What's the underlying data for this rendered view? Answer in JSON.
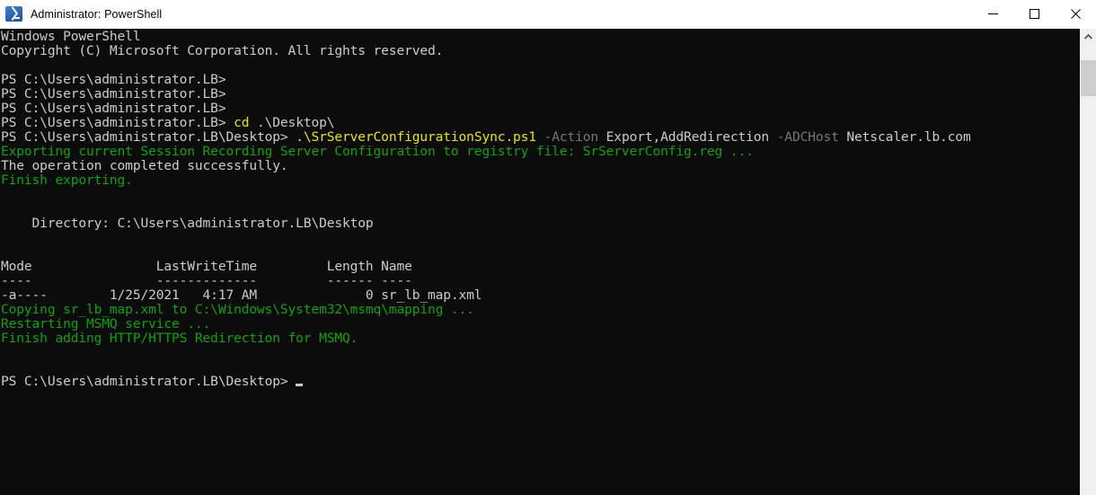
{
  "window": {
    "title": "Administrator: PowerShell",
    "icon": "powershell-icon",
    "background_color": "#0c0c0c",
    "titlebar_color": "#ffffff",
    "controls": {
      "minimize": "minimize-icon",
      "maximize": "maximize-icon",
      "close": "close-icon"
    }
  },
  "colors": {
    "foreground": "#cccccc",
    "green": "#13a10e",
    "yellow": "#e5e510",
    "gray": "#767676",
    "background": "#0c0c0c"
  },
  "scrollbar": {
    "up_arrow": "chevron-up-icon",
    "thumb_position_percent": 4
  },
  "console": {
    "lines": [
      {
        "id": "banner-1",
        "segments": [
          {
            "text": "Windows PowerShell",
            "color": "white"
          }
        ]
      },
      {
        "id": "banner-2",
        "segments": [
          {
            "text": "Copyright (C) Microsoft Corporation. All rights reserved.",
            "color": "white"
          }
        ]
      },
      {
        "id": "blank-1",
        "segments": [
          {
            "text": "",
            "color": "white"
          }
        ]
      },
      {
        "id": "prompt-1",
        "segments": [
          {
            "text": "PS C:\\Users\\administrator.LB>",
            "color": "white"
          }
        ]
      },
      {
        "id": "prompt-2",
        "segments": [
          {
            "text": "PS C:\\Users\\administrator.LB>",
            "color": "white"
          }
        ]
      },
      {
        "id": "prompt-3",
        "segments": [
          {
            "text": "PS C:\\Users\\administrator.LB>",
            "color": "white"
          }
        ]
      },
      {
        "id": "cmd-cd",
        "segments": [
          {
            "text": "PS C:\\Users\\administrator.LB> ",
            "color": "white"
          },
          {
            "text": "cd",
            "color": "yellow"
          },
          {
            "text": " .\\Desktop\\",
            "color": "white"
          }
        ]
      },
      {
        "id": "cmd-script",
        "segments": [
          {
            "text": "PS C:\\Users\\administrator.LB\\Desktop> ",
            "color": "white"
          },
          {
            "text": ".\\SrServerConfigurationSync.ps1",
            "color": "yellow"
          },
          {
            "text": " ",
            "color": "white"
          },
          {
            "text": "-Action",
            "color": "gray"
          },
          {
            "text": " Export,AddRedirection ",
            "color": "white"
          },
          {
            "text": "-ADCHost",
            "color": "gray"
          },
          {
            "text": " Netscaler.lb.com",
            "color": "white"
          }
        ]
      },
      {
        "id": "out-exporting",
        "segments": [
          {
            "text": "Exporting current Session Recording Server Configuration to registry file: SrServerConfig.reg ...",
            "color": "green"
          }
        ]
      },
      {
        "id": "out-success",
        "segments": [
          {
            "text": "The operation completed successfully.",
            "color": "white"
          }
        ]
      },
      {
        "id": "out-finish-export",
        "segments": [
          {
            "text": "Finish exporting.",
            "color": "green"
          }
        ]
      },
      {
        "id": "blank-2",
        "segments": [
          {
            "text": "",
            "color": "white"
          }
        ]
      },
      {
        "id": "blank-3",
        "segments": [
          {
            "text": "",
            "color": "white"
          }
        ]
      },
      {
        "id": "dir-header",
        "segments": [
          {
            "text": "    Directory: C:\\Users\\administrator.LB\\Desktop",
            "color": "white"
          }
        ]
      },
      {
        "id": "blank-4",
        "segments": [
          {
            "text": "",
            "color": "white"
          }
        ]
      },
      {
        "id": "blank-5",
        "segments": [
          {
            "text": "",
            "color": "white"
          }
        ]
      },
      {
        "id": "table-head",
        "segments": [
          {
            "text": "Mode                LastWriteTime         Length Name",
            "color": "white"
          }
        ]
      },
      {
        "id": "table-rule",
        "segments": [
          {
            "text": "----                -------------         ------ ----",
            "color": "white"
          }
        ]
      },
      {
        "id": "table-row-1",
        "segments": [
          {
            "text": "-a----        1/25/2021   4:17 AM              0 sr_lb_map.xml",
            "color": "white"
          }
        ]
      },
      {
        "id": "out-copying",
        "segments": [
          {
            "text": "Copying sr_lb_map.xml to C:\\Windows\\System32\\msmq\\mapping ...",
            "color": "green"
          }
        ]
      },
      {
        "id": "out-restarting",
        "segments": [
          {
            "text": "Restarting MSMQ service ...",
            "color": "green"
          }
        ]
      },
      {
        "id": "out-finish-redirect",
        "segments": [
          {
            "text": "Finish adding HTTP/HTTPS Redirection for MSMQ.",
            "color": "green"
          }
        ]
      },
      {
        "id": "blank-6",
        "segments": [
          {
            "text": "",
            "color": "white"
          }
        ]
      },
      {
        "id": "blank-7",
        "segments": [
          {
            "text": "",
            "color": "white"
          }
        ]
      },
      {
        "id": "prompt-final",
        "segments": [
          {
            "text": "PS C:\\Users\\administrator.LB\\Desktop>",
            "color": "white"
          }
        ],
        "cursor": true
      }
    ],
    "directory_listing": {
      "directory": "C:\\Users\\administrator.LB\\Desktop",
      "columns": [
        "Mode",
        "LastWriteTime",
        "Length",
        "Name"
      ],
      "rows": [
        {
          "mode": "-a----",
          "last_write_time": "1/25/2021   4:17 AM",
          "length": "0",
          "name": "sr_lb_map.xml"
        }
      ]
    },
    "command_history": [
      "cd .\\Desktop\\",
      ".\\SrServerConfigurationSync.ps1 -Action Export,AddRedirection -ADCHost Netscaler.lb.com"
    ]
  }
}
